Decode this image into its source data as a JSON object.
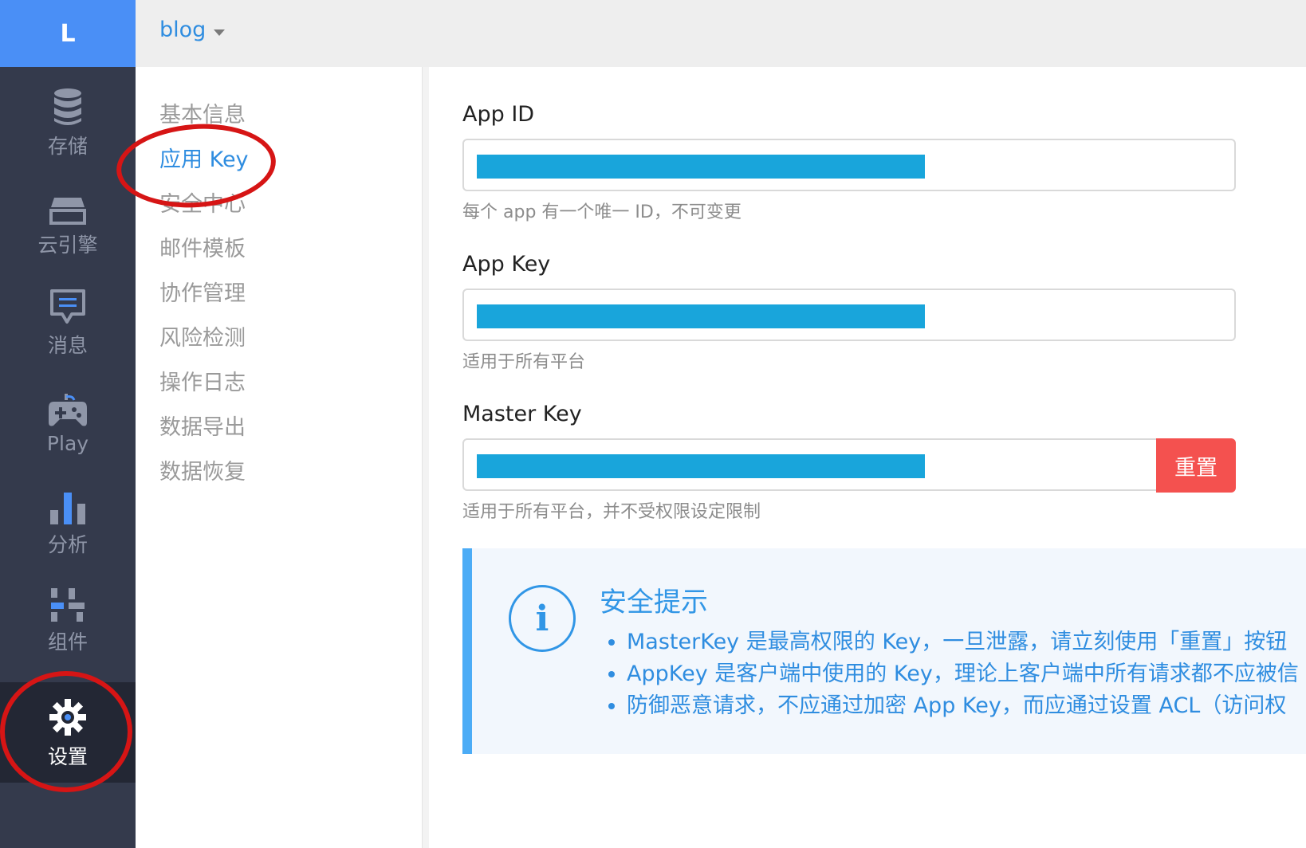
{
  "rail": {
    "logo": "L",
    "items": [
      {
        "label": "存储",
        "icon": "database-icon"
      },
      {
        "label": "云引擎",
        "icon": "cloud-engine-icon"
      },
      {
        "label": "消息",
        "icon": "message-icon"
      },
      {
        "label": "Play",
        "icon": "gamepad-icon"
      },
      {
        "label": "分析",
        "icon": "bar-chart-icon"
      },
      {
        "label": "组件",
        "icon": "components-icon"
      },
      {
        "label": "设置",
        "icon": "gear-icon",
        "active": true
      }
    ]
  },
  "topbar": {
    "app_name": "blog"
  },
  "subnav": {
    "items": [
      "基本信息",
      "应用 Key",
      "安全中心",
      "邮件模板",
      "协作管理",
      "风险检测",
      "操作日志",
      "数据导出",
      "数据恢复"
    ],
    "active": "应用 Key"
  },
  "fields": {
    "app_id": {
      "label": "App ID",
      "help": "每个 app 有一个唯一 ID，不可变更"
    },
    "app_key": {
      "label": "App Key",
      "help": "适用于所有平台"
    },
    "master_key": {
      "label": "Master Key",
      "help": "适用于所有平台，并不受权限设定限制",
      "reset_label": "重置"
    }
  },
  "notice": {
    "icon": "info-icon",
    "title": "安全提示",
    "items": [
      "MasterKey 是最高权限的 Key，一旦泄露，请立刻使用「重置」按钮",
      "AppKey 是客户端中使用的 Key，理论上客户端中所有请求都不应被信",
      "防御恶意请求，不应通过加密 App Key，而应通过设置 ACL（访问权"
    ]
  },
  "colors": {
    "accent": "#2f8de0",
    "rail_bg": "#343a4c",
    "logo_bg": "#4a8ff6",
    "danger": "#f4514f",
    "highlight_circle": "#d61515"
  }
}
